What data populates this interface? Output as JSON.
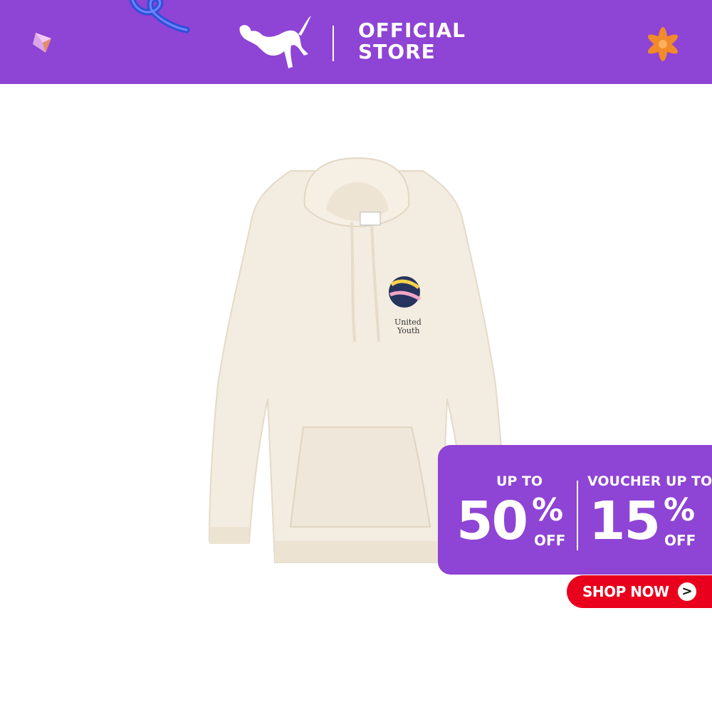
{
  "header": {
    "store_line1": "OFFICIAL",
    "store_line2": "STORE",
    "brand_icon": "puma-cat-icon"
  },
  "product": {
    "chest_print_line1": "United",
    "chest_print_line2": "Youth"
  },
  "promo": {
    "left_label": "UP TO",
    "left_value": "50",
    "right_label": "VOUCHER UP TO",
    "right_value": "15",
    "percent": "%",
    "off": "OFF"
  },
  "cta": {
    "label": "SHOP NOW",
    "arrow": ">"
  },
  "colors": {
    "brand_purple": "#8e44d4",
    "cta_red": "#e8001c",
    "hoodie_cream": "#f3ece0"
  }
}
